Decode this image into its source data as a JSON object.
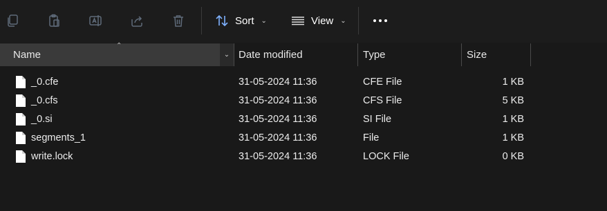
{
  "toolbar": {
    "icons": [
      "copy-icon",
      "paste-icon",
      "rename-icon",
      "share-icon",
      "delete-icon"
    ],
    "sort_label": "Sort",
    "view_label": "View",
    "more_icon": "more-icon"
  },
  "columns": {
    "name": "Name",
    "date": "Date modified",
    "type": "Type",
    "size": "Size"
  },
  "files": [
    {
      "name": "_0.cfe",
      "date": "31-05-2024 11:36",
      "type": "CFE File",
      "size": "1 KB"
    },
    {
      "name": "_0.cfs",
      "date": "31-05-2024 11:36",
      "type": "CFS File",
      "size": "5 KB"
    },
    {
      "name": "_0.si",
      "date": "31-05-2024 11:36",
      "type": "SI File",
      "size": "1 KB"
    },
    {
      "name": "segments_1",
      "date": "31-05-2024 11:36",
      "type": "File",
      "size": "1 KB"
    },
    {
      "name": "write.lock",
      "date": "31-05-2024 11:36",
      "type": "LOCK File",
      "size": "0 KB"
    }
  ]
}
